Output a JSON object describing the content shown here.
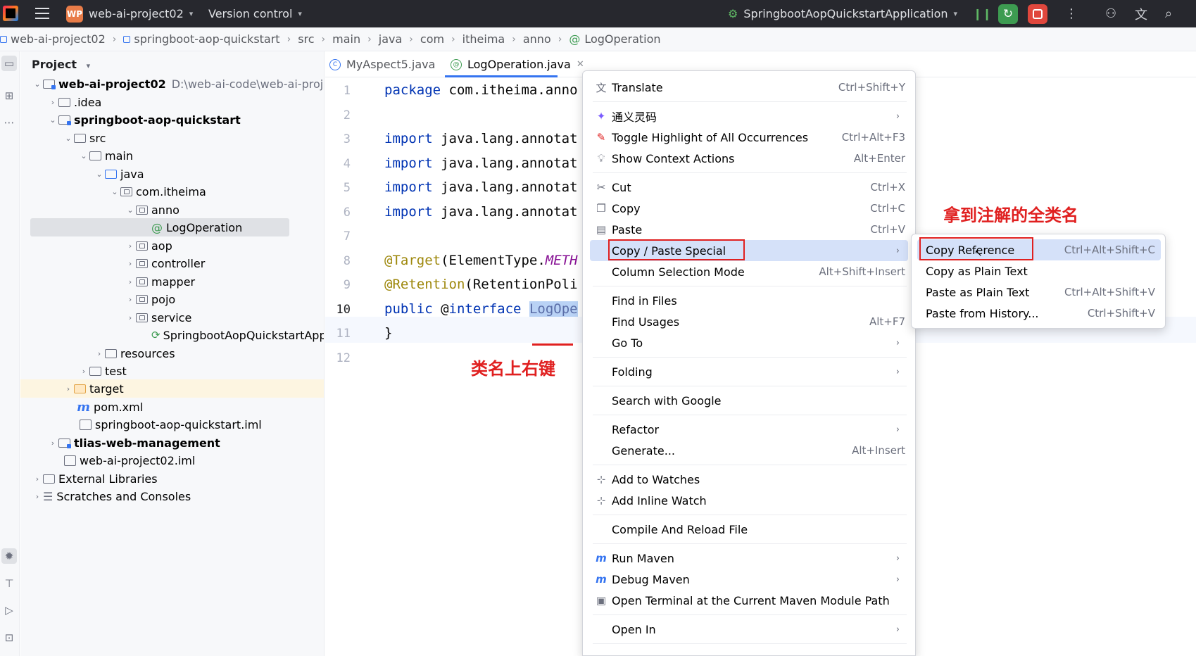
{
  "titlebar": {
    "project_badge": "WP",
    "project_name": "web-ai-project02",
    "vcs": "Version control",
    "run_config": "SpringbootAopQuickstartApplication"
  },
  "breadcrumb": [
    "web-ai-project02",
    "springboot-aop-quickstart",
    "src",
    "main",
    "java",
    "com",
    "itheima",
    "anno",
    "LogOperation"
  ],
  "project_pane": {
    "title": "Project",
    "tree": [
      {
        "label": "web-ai-project02",
        "path": "D:\\web-ai-code\\web-ai-proj",
        "bold": true
      },
      {
        "label": ".idea"
      },
      {
        "label": "springboot-aop-quickstart",
        "bold": true
      },
      {
        "label": "src"
      },
      {
        "label": "main"
      },
      {
        "label": "java"
      },
      {
        "label": "com.itheima"
      },
      {
        "label": "anno"
      },
      {
        "label": "LogOperation"
      },
      {
        "label": "aop"
      },
      {
        "label": "controller"
      },
      {
        "label": "mapper"
      },
      {
        "label": "pojo"
      },
      {
        "label": "service"
      },
      {
        "label": "SpringbootAopQuickstartApp"
      },
      {
        "label": "resources"
      },
      {
        "label": "test"
      },
      {
        "label": "target"
      },
      {
        "label": "pom.xml"
      },
      {
        "label": "springboot-aop-quickstart.iml"
      },
      {
        "label": "tlias-web-management",
        "bold": true
      },
      {
        "label": "web-ai-project02.iml"
      },
      {
        "label": "External Libraries"
      },
      {
        "label": "Scratches and Consoles"
      }
    ]
  },
  "editor": {
    "tabs": [
      {
        "label": "MyAspect5.java",
        "active": false
      },
      {
        "label": "LogOperation.java",
        "active": true
      }
    ],
    "lines": [
      "1",
      "2",
      "3",
      "4",
      "5",
      "6",
      "7",
      "8",
      "9",
      "10",
      "11",
      "12"
    ],
    "code": {
      "l1_kw": "package",
      "l1_rest": " com.itheima.anno",
      "l3_kw": "import",
      "l3_rest": " java.lang.annotat",
      "l4_kw": "import",
      "l4_rest": " java.lang.annotat",
      "l5_kw": "import",
      "l5_rest": " java.lang.annotat",
      "l6_kw": "import",
      "l6_rest": " java.lang.annotat",
      "l8_ann": "@Target",
      "l8_rest": "(ElementType.",
      "l8_it": "METH",
      "l9_ann": "@Retention",
      "l9_rest": "(RetentionPoli",
      "l10_kw": "public",
      "l10_mid": " @",
      "l10_kw2": "interface",
      "l10_name": "LogOpe",
      "l11": "}"
    },
    "note_right_click": "类名上右键",
    "note_copy_ref": "拿到注解的全类名"
  },
  "context_menu": {
    "items": [
      {
        "icon": "translate-icon",
        "label": "Translate",
        "key": "Ctrl+Shift+Y"
      },
      {
        "icon": "tongyi-icon",
        "label": "通义灵码",
        "submenu": true
      },
      {
        "icon": "highlight-icon",
        "label": "Toggle Highlight of All Occurrences",
        "key": "Ctrl+Alt+F3"
      },
      {
        "icon": "bulb-icon",
        "label": "Show Context Actions",
        "key": "Alt+Enter"
      },
      {
        "icon": "scissors-icon",
        "label": "Cut",
        "key": "Ctrl+X"
      },
      {
        "icon": "copy-icon",
        "label": "Copy",
        "key": "Ctrl+C"
      },
      {
        "icon": "paste-icon",
        "label": "Paste",
        "key": "Ctrl+V"
      },
      {
        "icon": "",
        "label": "Copy / Paste Special",
        "submenu": true
      },
      {
        "icon": "",
        "label": "Column Selection Mode",
        "key": "Alt+Shift+Insert"
      },
      {
        "icon": "",
        "label": "Find in Files"
      },
      {
        "icon": "",
        "label": "Find Usages",
        "key": "Alt+F7"
      },
      {
        "icon": "",
        "label": "Go To",
        "submenu": true
      },
      {
        "icon": "",
        "label": "Folding",
        "submenu": true
      },
      {
        "icon": "",
        "label": "Search with Google"
      },
      {
        "icon": "",
        "label": "Refactor",
        "submenu": true
      },
      {
        "icon": "",
        "label": "Generate...",
        "key": "Alt+Insert"
      },
      {
        "icon": "watch-icon",
        "label": "Add to Watches"
      },
      {
        "icon": "watch-icon",
        "label": "Add Inline Watch"
      },
      {
        "icon": "",
        "label": "Compile And Reload File"
      },
      {
        "icon": "maven-icon",
        "label": "Run Maven",
        "submenu": true
      },
      {
        "icon": "maven-debug-icon",
        "label": "Debug Maven",
        "submenu": true
      },
      {
        "icon": "terminal-icon",
        "label": "Open Terminal at the Current Maven Module Path"
      },
      {
        "icon": "",
        "label": "Open In",
        "submenu": true
      }
    ]
  },
  "submenu": {
    "items": [
      {
        "label": "Copy Reference",
        "key": "Ctrl+Alt+Shift+C"
      },
      {
        "label": "Copy as Plain Text",
        "key": ""
      },
      {
        "label": "Paste as Plain Text",
        "key": "Ctrl+Alt+Shift+V"
      },
      {
        "label": "Paste from History...",
        "key": "Ctrl+Shift+V"
      }
    ]
  },
  "colors": {
    "titlebar_bg": "#27282e",
    "hover_bg": "#d5e1f9",
    "annotation_red": "#e02020",
    "keyword": "#0033b3",
    "annotation": "#9e880d"
  }
}
